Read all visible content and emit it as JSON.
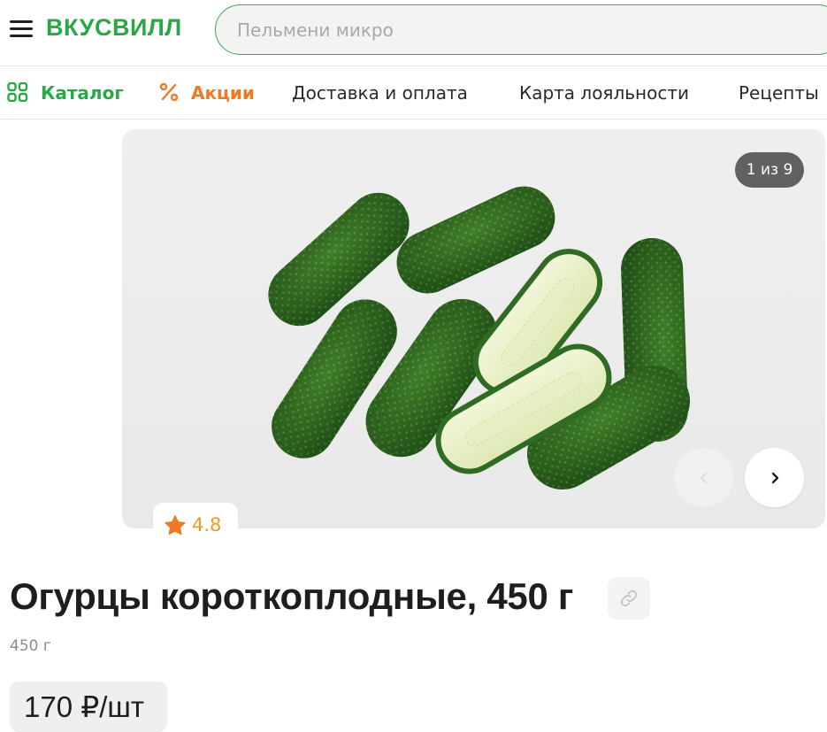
{
  "header": {
    "logo": "ВКУСВИЛЛ",
    "search_placeholder": "Пельмени микро",
    "brand_color": "#2aa846"
  },
  "nav": {
    "catalog": "Каталог",
    "promo": "Акции",
    "delivery": "Доставка и оплата",
    "loyalty": "Карта лояльности",
    "recipes": "Рецепты"
  },
  "gallery": {
    "counter": "1 из 9",
    "current": 1,
    "total": 9
  },
  "product": {
    "rating": "4.8",
    "title": "Огурцы короткоплодные, 450 г",
    "weight": "450 г",
    "price": "170 ₽/шт"
  },
  "icons": {
    "menu": "burger-menu-icon",
    "catalog": "grid-icon",
    "promo": "percent-icon",
    "star": "star-icon",
    "link": "link-icon",
    "prev": "chevron-left-icon",
    "next": "chevron-right-icon"
  }
}
